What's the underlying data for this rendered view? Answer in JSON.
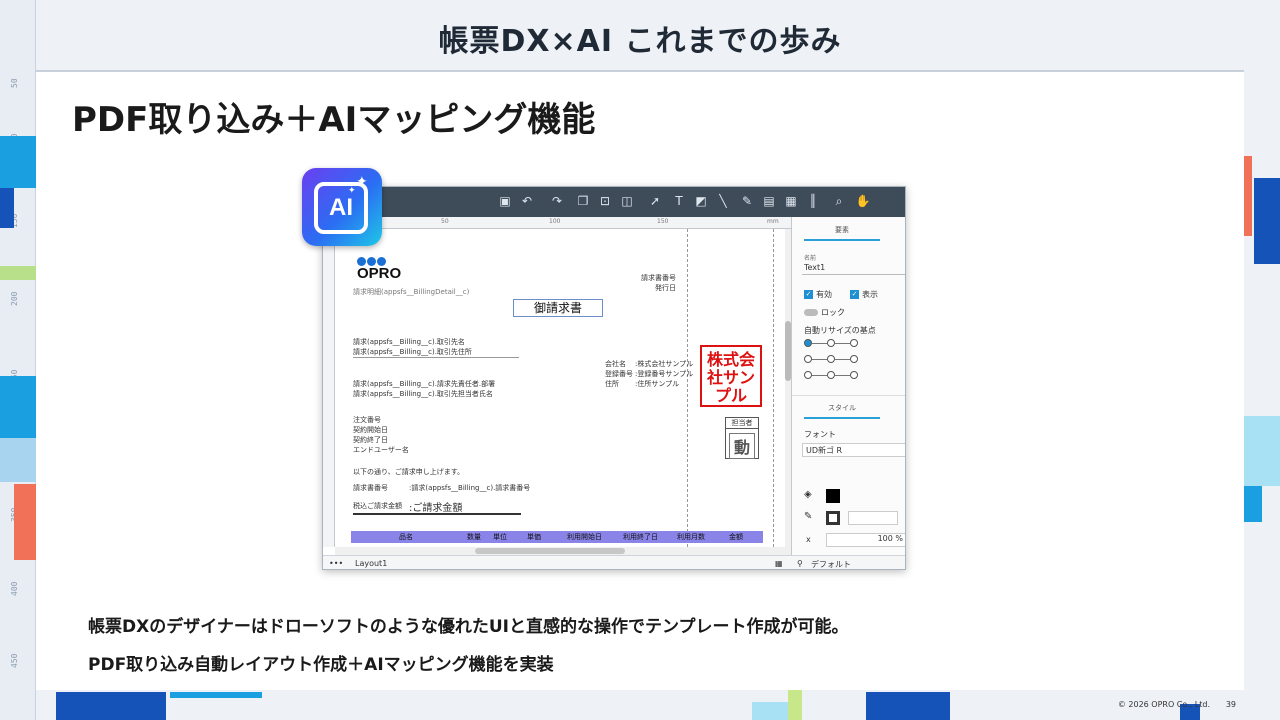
{
  "slide": {
    "header": "帳票DX×AI これまでの歩み",
    "title": "PDF取り込み＋AIマッピング機能",
    "caption_line1": "帳票DXのデザイナーはドローソフトのような優れたUIと直感的な操作でテンプレート作成が可能。",
    "caption_line2": "PDF取り込み自動レイアウト作成＋AIマッピング機能を実装",
    "copyright": "© 2026 OPRO Co., Ltd.",
    "page_number": "39"
  },
  "ruler": {
    "labels": [
      "50",
      "100",
      "150",
      "200",
      "250",
      "300",
      "350",
      "400",
      "450"
    ]
  },
  "ai_badge": {
    "label": "AI",
    "icon": "sparkle-icon"
  },
  "designer": {
    "ruler_marks": [
      "50",
      "100",
      "150",
      "mm"
    ],
    "logo_text": "OPRO",
    "fields": {
      "billing_detail": "請求明細(appsfs__BillingDetail__c)",
      "doc_title": "御請求書",
      "invoice_no_label": "請求書番号",
      "issue_date_label": "発行日",
      "billing_company": "請求(appsfs__Billing__c).取引先名",
      "billing_address": "請求(appsfs__Billing__c).取引先住所",
      "billing_person_dept": "請求(appsfs__Billing__c).請求先責任者.部署",
      "billing_person_name": "請求(appsfs__Billing__c).取引先担当者氏名",
      "company_name": "会社名",
      "company_name_value": ":株式会社サンプル",
      "reg_no": "登録番号",
      "reg_no_value": ":登録番号サンプル",
      "address": "住所",
      "address_value": ":住所サンプル",
      "order_no": "注文番号",
      "contract_start": "契約開始日",
      "contract_end": "契約終了日",
      "end_user": "エンドユーザー名",
      "request_text": "以下の通り、ご請求申し上げます。",
      "invoice_no2": "請求書番号",
      "invoice_no2_value": ":請求(appsfs__Billing__c).請求書番号",
      "total_label": "税込ご請求金額",
      "total_value": ":ご請求金額",
      "seal_text": "株式会社サンプル",
      "stamp_label": "担当者",
      "stamp_char": "動"
    },
    "table_headers": [
      "品名",
      "数量",
      "単位",
      "単価",
      "利用開始日",
      "利用終了日",
      "利用月数",
      "金額"
    ],
    "layout_name": "Layout1",
    "status_default": "デフォルト",
    "panel": {
      "tab_attr": "要素",
      "name_label": "名前",
      "name_value": "Text1",
      "enabled": "有効",
      "visible": "表示",
      "lock": "ロック",
      "auto_resize": "自動リサイズの基点",
      "tab_style": "スタイル",
      "font_label": "フォント",
      "font_value": "UD新ゴ R",
      "x_label": "x",
      "scale_value": "100 %"
    }
  },
  "colors": {
    "accent_blue": "#1a6fd4",
    "table_header": "#8b84e8",
    "seal_red": "#d11111",
    "toolbar": "#3e4c5a"
  }
}
